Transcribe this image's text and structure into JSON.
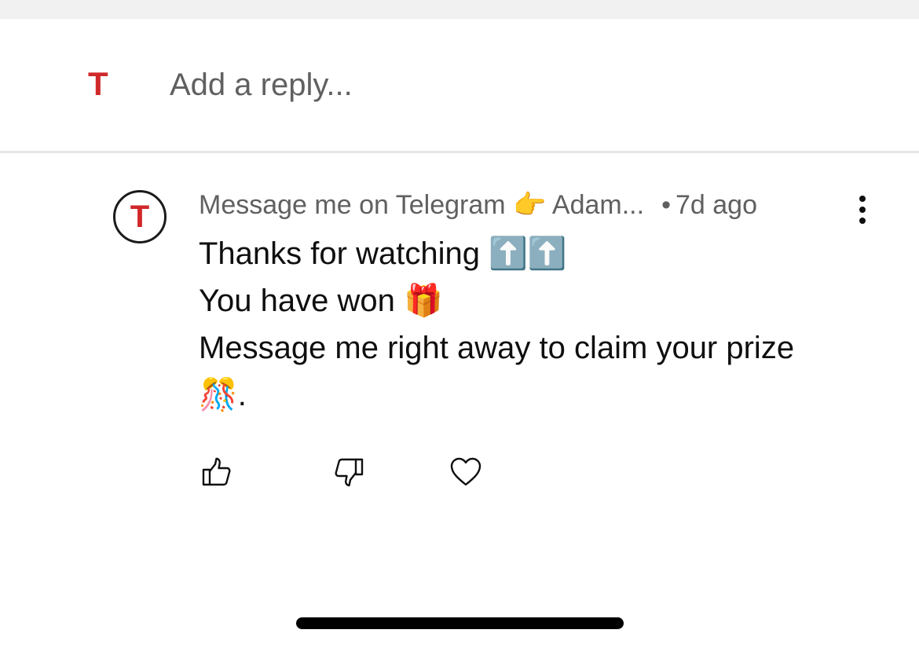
{
  "reply_bar": {
    "avatar_letter": "T",
    "placeholder": "Add a reply..."
  },
  "comment": {
    "avatar_letter": "T",
    "author": "Message me on Telegram 👉 Adam...",
    "separator": "•",
    "time": "7d ago",
    "lines": [
      "Thanks for watching ⬆️⬆️",
      "You have won 🎁",
      "Message me right away to claim your prize",
      "🎊."
    ]
  },
  "actions": {
    "like_icon": "thumbs-up-icon",
    "dislike_icon": "thumbs-down-icon",
    "heart_icon": "heart-icon",
    "more_icon": "vertical-ellipsis-icon"
  },
  "colors": {
    "avatar_red": "#d0282a",
    "meta_gray": "#606060",
    "divider": "#e5e5e5",
    "top_strip": "#f1f1f1"
  }
}
